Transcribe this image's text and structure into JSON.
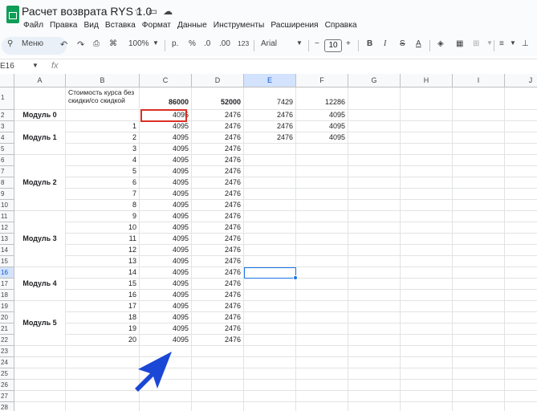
{
  "app": {
    "title": "Расчет возврата RYS 1.0",
    "icons": [
      "star-icon",
      "folder-icon",
      "cloud-icon"
    ],
    "menus": [
      "Файл",
      "Правка",
      "Вид",
      "Вставка",
      "Формат",
      "Данные",
      "Инструменты",
      "Расширения",
      "Справка"
    ]
  },
  "toolbar": {
    "search_label": "Меню",
    "zoom": "100%",
    "currency": "р.",
    "percent": "%",
    "dec_less": ".0",
    "dec_more": ".00",
    "number_format": "123",
    "font": "Arial",
    "font_size": "10",
    "minus": "−",
    "plus": "+",
    "bold": "B",
    "italic": "I",
    "strike": "S",
    "text_color": "A"
  },
  "formula_bar": {
    "name_box": "E16",
    "fx": "fx"
  },
  "columns": [
    "A",
    "B",
    "C",
    "D",
    "E",
    "F",
    "G",
    "H",
    "I",
    "J"
  ],
  "selected_cell": "E16",
  "rows": {
    "r1": {
      "b": "Стоимость курса без скидки/со скидкой",
      "c": "86000",
      "d": "52000",
      "e": "7429",
      "f": "12286"
    },
    "r2": {
      "c": "4095",
      "d": "2476",
      "e": "2476",
      "f": "4095"
    },
    "r3": {
      "b": "1",
      "c": "4095",
      "d": "2476",
      "e": "2476",
      "f": "4095"
    },
    "r4": {
      "b": "2",
      "c": "4095",
      "d": "2476",
      "e": "2476",
      "f": "4095"
    },
    "r5": {
      "b": "3",
      "c": "4095",
      "d": "2476"
    },
    "r6": {
      "b": "4",
      "c": "4095",
      "d": "2476"
    },
    "r7": {
      "b": "5",
      "c": "4095",
      "d": "2476"
    },
    "r8": {
      "b": "6",
      "c": "4095",
      "d": "2476"
    },
    "r9": {
      "b": "7",
      "c": "4095",
      "d": "2476"
    },
    "r10": {
      "b": "8",
      "c": "4095",
      "d": "2476"
    },
    "r11": {
      "b": "9",
      "c": "4095",
      "d": "2476"
    },
    "r12": {
      "b": "10",
      "c": "4095",
      "d": "2476"
    },
    "r13": {
      "b": "11",
      "c": "4095",
      "d": "2476"
    },
    "r14": {
      "b": "12",
      "c": "4095",
      "d": "2476"
    },
    "r15": {
      "b": "13",
      "c": "4095",
      "d": "2476"
    },
    "r16": {
      "b": "14",
      "c": "4095",
      "d": "2476"
    },
    "r17": {
      "b": "15",
      "c": "4095",
      "d": "2476"
    },
    "r18": {
      "b": "16",
      "c": "4095",
      "d": "2476"
    },
    "r19": {
      "b": "17",
      "c": "4095",
      "d": "2476"
    },
    "r20": {
      "b": "18",
      "c": "4095",
      "d": "2476"
    },
    "r21": {
      "b": "19",
      "c": "4095",
      "d": "2476"
    },
    "r22": {
      "b": "20",
      "c": "4095",
      "d": "2476"
    }
  },
  "modules": {
    "m0": "Модуль 0",
    "m1": "Модуль 1",
    "m2": "Модуль  2",
    "m3": "Модуль  3",
    "m4": "Модуль  4",
    "m5": "Модуль  5"
  },
  "row_numbers": [
    "1",
    "2",
    "3",
    "4",
    "5",
    "6",
    "7",
    "8",
    "9",
    "10",
    "11",
    "12",
    "13",
    "14",
    "15",
    "16",
    "17",
    "18",
    "19",
    "20",
    "21",
    "22",
    "23",
    "24",
    "25",
    "26",
    "27",
    "28"
  ],
  "colors": {
    "accent": "#1a73e8",
    "highlight_border": "#d93025",
    "logo": "#0f9d58"
  }
}
